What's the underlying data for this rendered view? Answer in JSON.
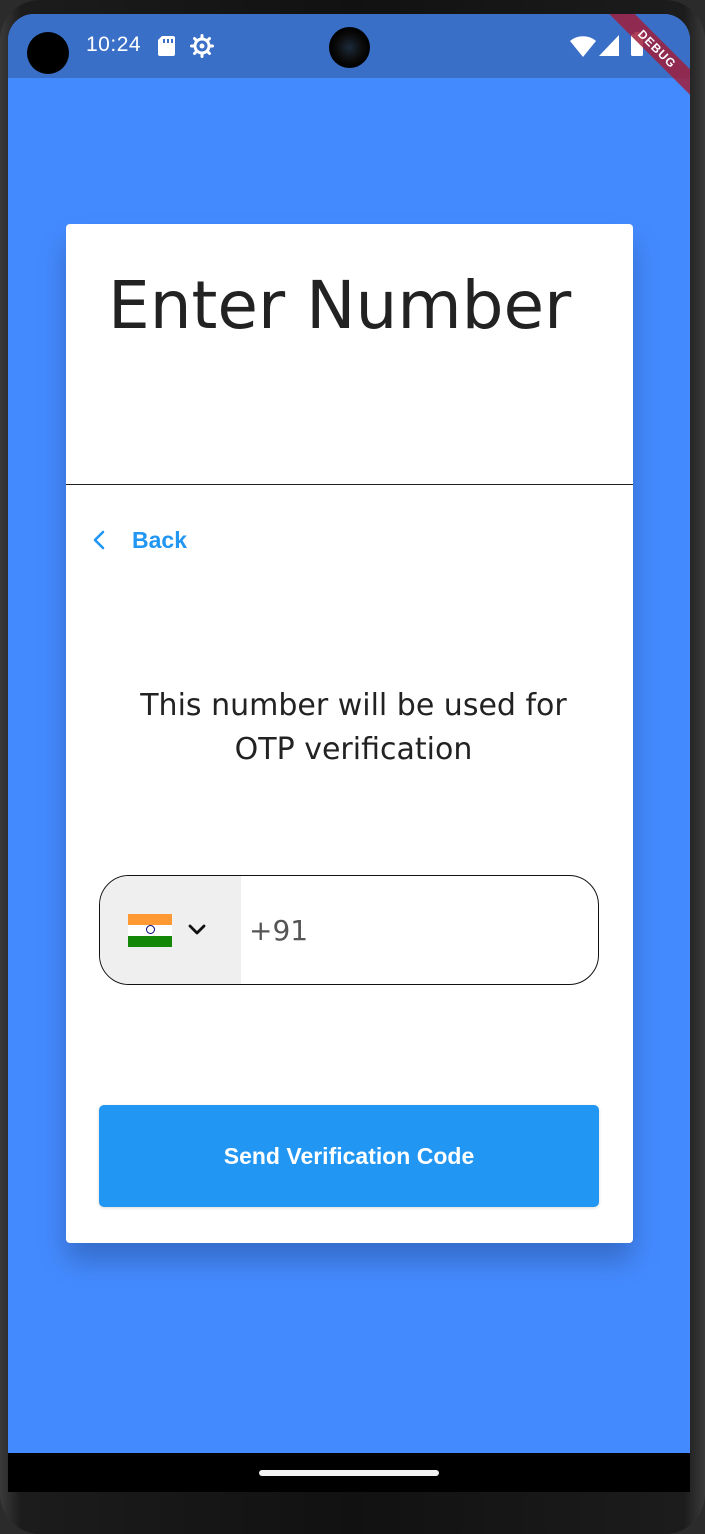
{
  "status_bar": {
    "time": "10:24",
    "icons": [
      "sd-card-icon",
      "gear-icon",
      "wifi-icon",
      "signal-icon",
      "battery-icon"
    ]
  },
  "debug_banner": "DEBUG",
  "card": {
    "title": "Enter Number",
    "back_label": "Back",
    "subtitle": "This number will be used for OTP verification",
    "phone": {
      "country_flag": "india-flag-icon",
      "placeholder": "+91",
      "value": ""
    },
    "send_button_label": "Send Verification Code"
  },
  "colors": {
    "background": "#448AFF",
    "status_bar": "#3A6FC7",
    "accent": "#2196F3",
    "card": "#FFFFFF"
  }
}
